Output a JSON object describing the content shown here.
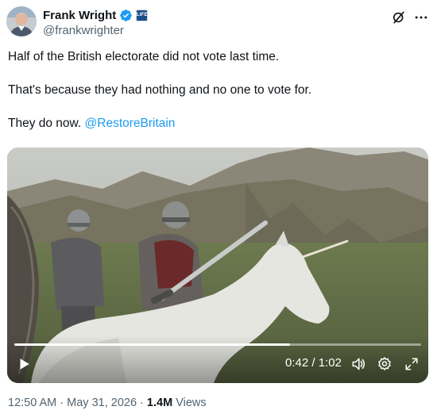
{
  "author": {
    "display_name": "Frank Wright",
    "handle": "@frankwrighter",
    "affiliate_badge": "LIFE"
  },
  "icons": {
    "verified": "verified-badge-icon",
    "grok": "grok-icon",
    "more": "more-icon",
    "play": "play-icon",
    "volume": "volume-icon",
    "settings": "settings-icon",
    "fullscreen": "fullscreen-icon"
  },
  "tweet": {
    "line1": "Half of the British electorate did not vote last time.",
    "line2": "That's because they had nothing and no one to vote for.",
    "line3_prefix": "They do now. ",
    "mention": "@RestoreBritain"
  },
  "video": {
    "time_display": "0:42 / 1:02",
    "progress": 0.677
  },
  "meta": {
    "time": "12:50 AM",
    "separator1": " · ",
    "date": "May 31, 2026",
    "separator2": " · ",
    "views_count": "1.4M",
    "views_label": " Views"
  },
  "colors": {
    "link": "#1d9bf0",
    "verified": "#1d9bf0",
    "secondary_text": "#536471"
  }
}
